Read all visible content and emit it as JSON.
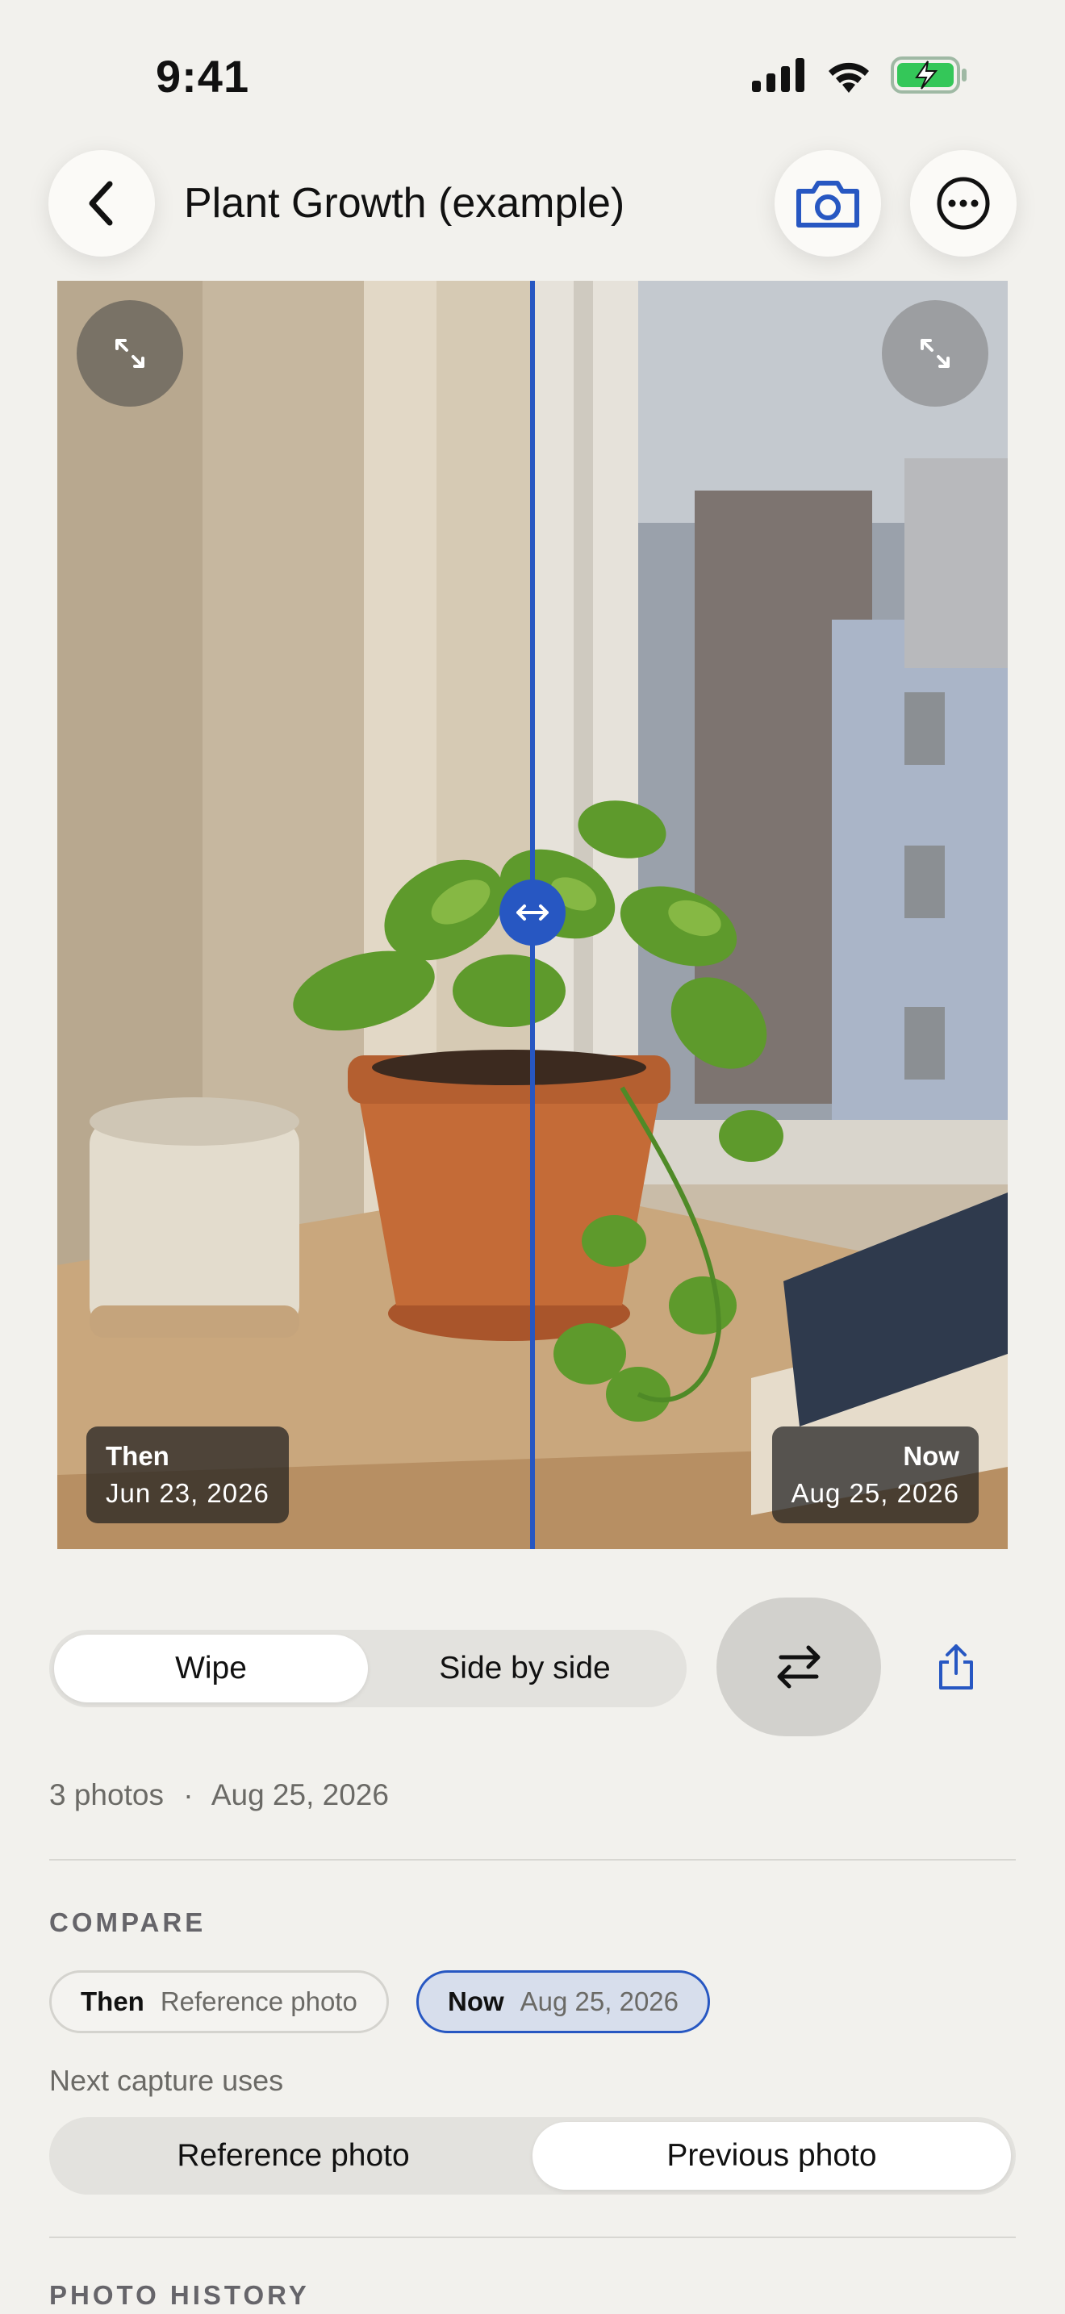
{
  "status_bar": {
    "time": "9:41"
  },
  "header": {
    "title": "Plant Growth (example)",
    "back_icon": "chevron-left-icon",
    "camera_icon": "camera-icon",
    "more_icon": "ellipsis-circle-icon"
  },
  "compare_view": {
    "then": {
      "label": "Then",
      "date": "Jun 23, 2026"
    },
    "now": {
      "label": "Now",
      "date": "Aug 25, 2026"
    },
    "divider_color": "#2757c2"
  },
  "mode_toggle": {
    "options": [
      "Wipe",
      "Side by side"
    ],
    "selected": "Wipe"
  },
  "summary": {
    "photos": "3 photos",
    "separator": "·",
    "date": "Aug 25, 2026"
  },
  "compare_section": {
    "title": "COMPARE",
    "then_chip": {
      "key": "Then",
      "value": "Reference photo"
    },
    "now_chip": {
      "key": "Now",
      "value": "Aug 25, 2026"
    }
  },
  "next_capture": {
    "label": "Next capture uses",
    "options": [
      "Reference photo",
      "Previous photo"
    ],
    "selected": "Previous photo"
  },
  "history_section": {
    "title": "PHOTO HISTORY"
  },
  "colors": {
    "accent": "#2757c2",
    "background": "#f2f1ed",
    "battery": "#34c759"
  }
}
